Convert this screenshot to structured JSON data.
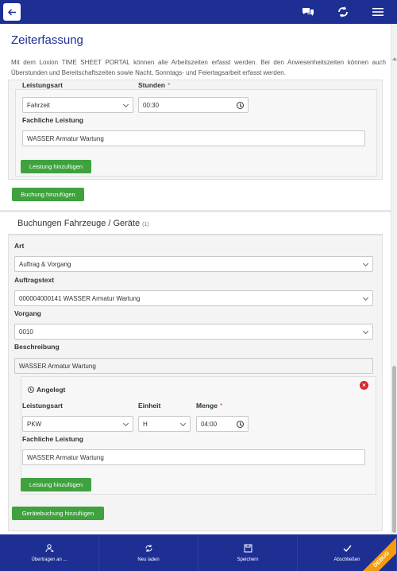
{
  "header": {
    "back_icon": "arrow-left-icon",
    "chat_icon": "chat-bubbles-icon",
    "sync_icon": "sync-icon",
    "menu_icon": "hamburger-menu-icon"
  },
  "page": {
    "title": "Zeiterfassung",
    "intro": "Mit dem Loxion TIME SHEET PORTAL können alle Arbeitszeiten erfasst werden. Bei den Anwesenheitszeiten können auch Überstunden und Bereitschaftszeiten sowie Nacht, Sonntags- und Feiertagsarbeit erfasst werden."
  },
  "buchung": {
    "leistungsart_label": "Leistungsart",
    "leistungsart_value": "Fahrzeit",
    "stunden_label": "Stunden",
    "stunden_required": "*",
    "stunden_value": "00:30",
    "fachliche_label": "Fachliche Leistung",
    "fachliche_value": "WASSER Armatur Wartung",
    "add_leistung": "Leistung hinzufügen",
    "add_buchung": "Buchung hinzufügen"
  },
  "fahrzeuge": {
    "title": "Buchungen Fahrzeuge / Geräte",
    "count": "(1)",
    "art_label": "Art",
    "art_value": "Auftrag & Vorgang",
    "auftrag_label": "Auftragstext",
    "auftrag_value": "000004000141 WASSER Armatur Wartung",
    "vorgang_label": "Vorgang",
    "vorgang_value": "0010",
    "beschreibung_label": "Beschreibung",
    "beschreibung_value": "WASSER Armatur Wartung",
    "status": "Angelegt",
    "leistungsart_label": "Leistungsart",
    "leistungsart_value": "PKW",
    "einheit_label": "Einheit",
    "einheit_value": "H",
    "menge_label": "Menge",
    "menge_required": "*",
    "menge_value": "04:00",
    "fachliche_label": "Fachliche Leistung",
    "fachliche_value": "WASSER Armatur Wartung",
    "add_leistung": "Leistung hinzufügen",
    "add_geraet": "Gerätebuchung hinzufügen"
  },
  "bottom": {
    "items": [
      {
        "label": "Übertragen an ...",
        "icon": "person-transfer-icon"
      },
      {
        "label": "Neu laden",
        "icon": "reload-icon"
      },
      {
        "label": "Speichern",
        "icon": "save-icon"
      },
      {
        "label": "Abschließen",
        "icon": "check-icon"
      }
    ],
    "debug": "DEBUG"
  },
  "colors": {
    "brand": "#1e2f94",
    "button_green": "#3fa23f",
    "required_red": "#d9534f",
    "debug_orange": "#f39c12"
  }
}
